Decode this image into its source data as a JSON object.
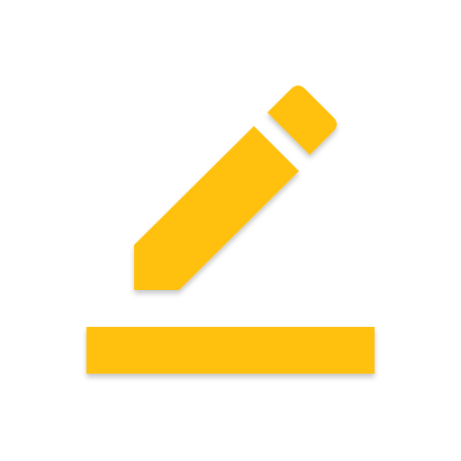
{
  "icon": {
    "name": "edit-pencil-with-line",
    "colors": {
      "fill": "#FFC107",
      "background": "#FFFFFF"
    }
  }
}
